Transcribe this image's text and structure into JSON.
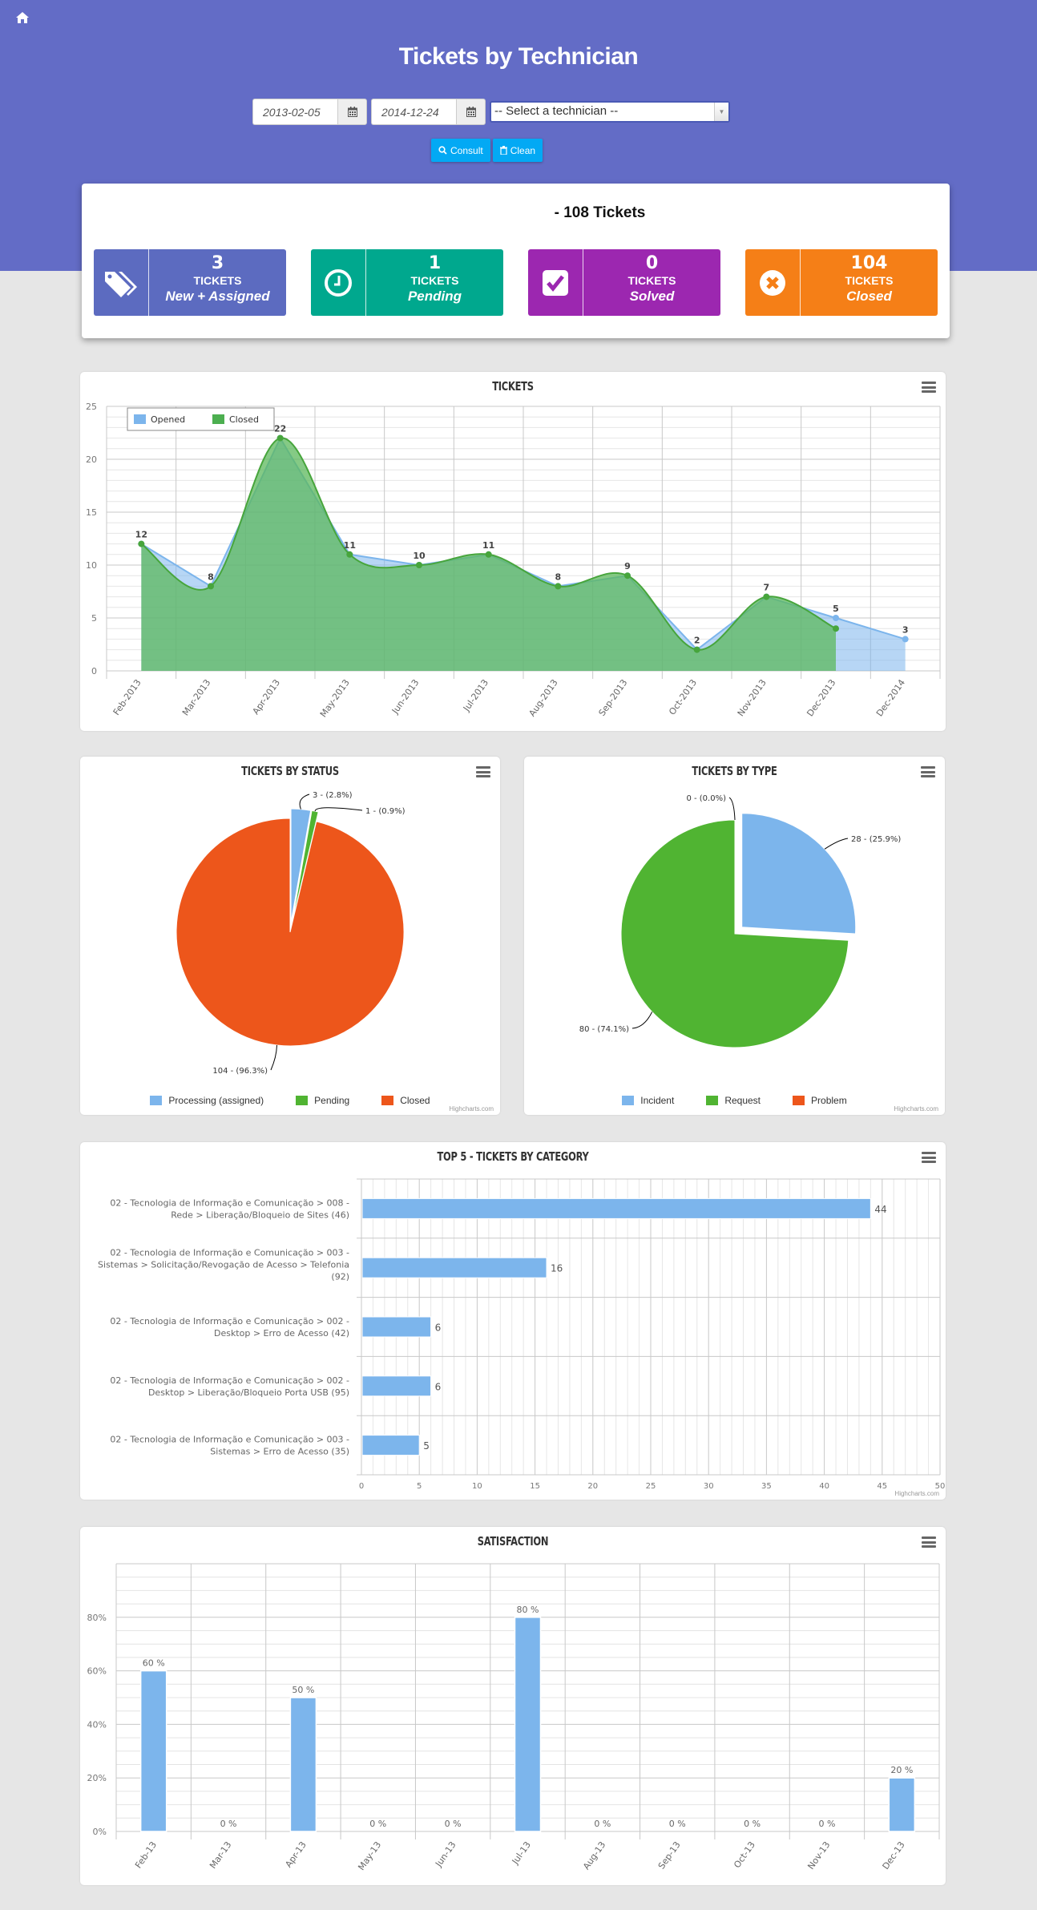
{
  "header": {
    "title": "Tickets by Technician",
    "home_icon": "home-icon",
    "date_from": "2013-02-05",
    "date_to": "2014-12-24",
    "technician_select": "-- Select a technician --",
    "consult_label": "Consult",
    "clean_label": "Clean"
  },
  "summary": {
    "total": "- 108 Tickets",
    "cards": [
      {
        "value": "3",
        "label": "TICKETS",
        "status": "New + Assigned",
        "icon": "tags-icon",
        "color": "#5c6bc0"
      },
      {
        "value": "1",
        "label": "TICKETS",
        "status": "Pending",
        "icon": "clock-icon",
        "color": "#00a88e"
      },
      {
        "value": "0",
        "label": "TICKETS",
        "status": "Solved",
        "icon": "check-square-icon",
        "color": "#9c27b0"
      },
      {
        "value": "104",
        "label": "TICKETS",
        "status": "Closed",
        "icon": "times-circle-icon",
        "color": "#f57f17"
      }
    ]
  },
  "credit": "Highcharts.com",
  "chart_data": [
    {
      "type": "area",
      "title": "TICKETS",
      "categories": [
        "Feb-2013",
        "Mar-2013",
        "Apr-2013",
        "May-2013",
        "Jun-2013",
        "Jul-2013",
        "Aug-2013",
        "Sep-2013",
        "Oct-2013",
        "Nov-2013",
        "Dec-2013",
        "Dec-2014"
      ],
      "series": [
        {
          "name": "Opened",
          "color": "#7cb5ec",
          "values": [
            12,
            8,
            22,
            11,
            10,
            11,
            8,
            9,
            2,
            7,
            5,
            3
          ]
        },
        {
          "name": "Closed",
          "color": "#4caf50",
          "values": [
            12,
            8,
            22,
            11,
            10,
            11,
            8,
            9,
            2,
            7,
            4,
            null
          ]
        }
      ],
      "data_labels": [
        12,
        8,
        22,
        11,
        10,
        11,
        8,
        9,
        2,
        7,
        5,
        3
      ],
      "ylim": [
        0,
        25
      ],
      "yticks": [
        0,
        5,
        10,
        15,
        20,
        25
      ],
      "legend": "top-left",
      "grid": true
    },
    {
      "type": "pie",
      "title": "TICKETS BY STATUS",
      "slices": [
        {
          "name": "Processing (assigned)",
          "value": 3,
          "percent": 2.8,
          "label": "3 - (2.8%)",
          "color": "#7cb5ec"
        },
        {
          "name": "Pending",
          "value": 1,
          "percent": 0.9,
          "label": "1 - (0.9%)",
          "color": "#50b432"
        },
        {
          "name": "Closed",
          "value": 104,
          "percent": 96.3,
          "label": "104 - (96.3%)",
          "color": "#ed561b"
        }
      ],
      "legend": "bottom"
    },
    {
      "type": "pie",
      "title": "TICKETS BY TYPE",
      "slices": [
        {
          "name": "Incident",
          "value": 28,
          "percent": 25.9,
          "label": "28 - (25.9%)",
          "color": "#7cb5ec"
        },
        {
          "name": "Request",
          "value": 80,
          "percent": 74.1,
          "label": "80 - (74.1%)",
          "color": "#50b432"
        },
        {
          "name": "Problem",
          "value": 0,
          "percent": 0.0,
          "label": "0 - (0.0%)",
          "color": "#ed561b"
        }
      ],
      "legend": "bottom"
    },
    {
      "type": "bar",
      "orientation": "horizontal",
      "title": "TOP 5 - TICKETS BY CATEGORY",
      "categories": [
        [
          "02 - Tecnologia de Informação e Comunicação > 008 -",
          "Rede > Liberação/Bloqueio de Sites (46)"
        ],
        [
          "02 - Tecnologia de Informação e Comunicação > 003 -",
          "Sistemas > Solicitação/Revogação de Acesso > Telefonia",
          "(92)"
        ],
        [
          "02 - Tecnologia de Informação e Comunicação > 002 -",
          "Desktop > Erro de Acesso (42)"
        ],
        [
          "02 - Tecnologia de Informação e Comunicação > 002 -",
          "Desktop > Liberação/Bloqueio Porta USB (95)"
        ],
        [
          "02 - Tecnologia de Informação e Comunicação > 003 -",
          "Sistemas > Erro de Acesso (35)"
        ]
      ],
      "values": [
        44,
        16,
        6,
        6,
        5
      ],
      "color": "#7cb5ec",
      "xlim": [
        0,
        50
      ],
      "xticks": [
        0,
        5,
        10,
        15,
        20,
        25,
        30,
        35,
        40,
        45,
        50
      ]
    },
    {
      "type": "bar",
      "title": "SATISFACTION",
      "categories": [
        "Feb-13",
        "Mar-13",
        "Apr-13",
        "May-13",
        "Jun-13",
        "Jul-13",
        "Aug-13",
        "Sep-13",
        "Oct-13",
        "Nov-13",
        "Dec-13"
      ],
      "values": [
        60,
        0,
        50,
        0,
        0,
        80,
        0,
        0,
        0,
        0,
        20
      ],
      "value_suffix": " %",
      "color": "#7cb5ec",
      "ylim": [
        0,
        100
      ],
      "yticks": [
        0,
        20,
        40,
        60,
        80
      ],
      "ytick_suffix": "%"
    }
  ]
}
